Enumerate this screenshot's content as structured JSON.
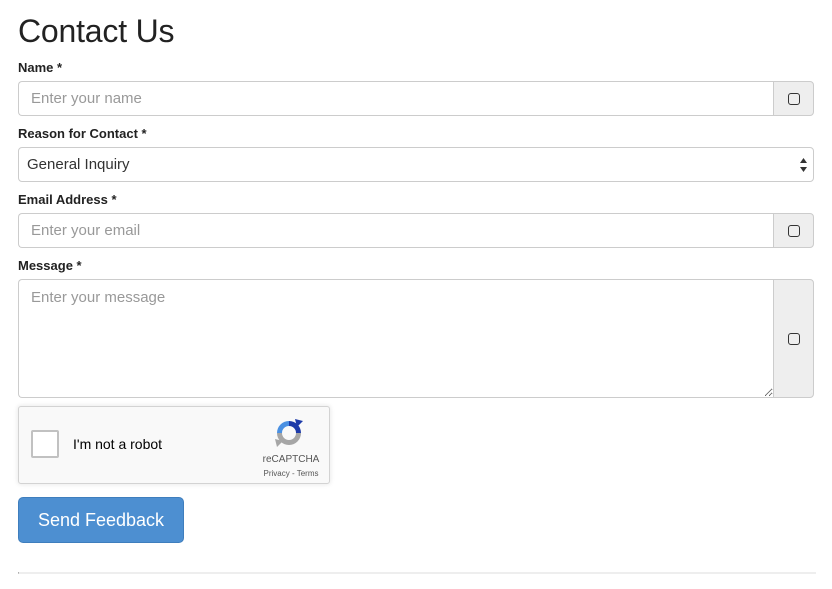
{
  "page": {
    "title": "Contact Us"
  },
  "form": {
    "name": {
      "label": "Name *",
      "placeholder": "Enter your name",
      "value": ""
    },
    "reason": {
      "label": "Reason for Contact *",
      "selected": "General Inquiry"
    },
    "email": {
      "label": "Email Address *",
      "placeholder": "Enter your email",
      "value": ""
    },
    "message": {
      "label": "Message *",
      "placeholder": "Enter your message",
      "value": ""
    },
    "recaptcha": {
      "label": "I'm not a robot",
      "brand": "reCAPTCHA",
      "privacy": "Privacy",
      "separator": " - ",
      "terms": "Terms",
      "checked": false
    },
    "submit_label": "Send Feedback"
  },
  "icons": {
    "field_addon": "square-icon",
    "select_arrows": "up-down-arrows-icon",
    "recaptcha_logo": "recaptcha-logo-icon"
  },
  "colors": {
    "primary_button": "#4d8fd1",
    "addon_background": "#eeeeee",
    "border": "#cccccc"
  }
}
